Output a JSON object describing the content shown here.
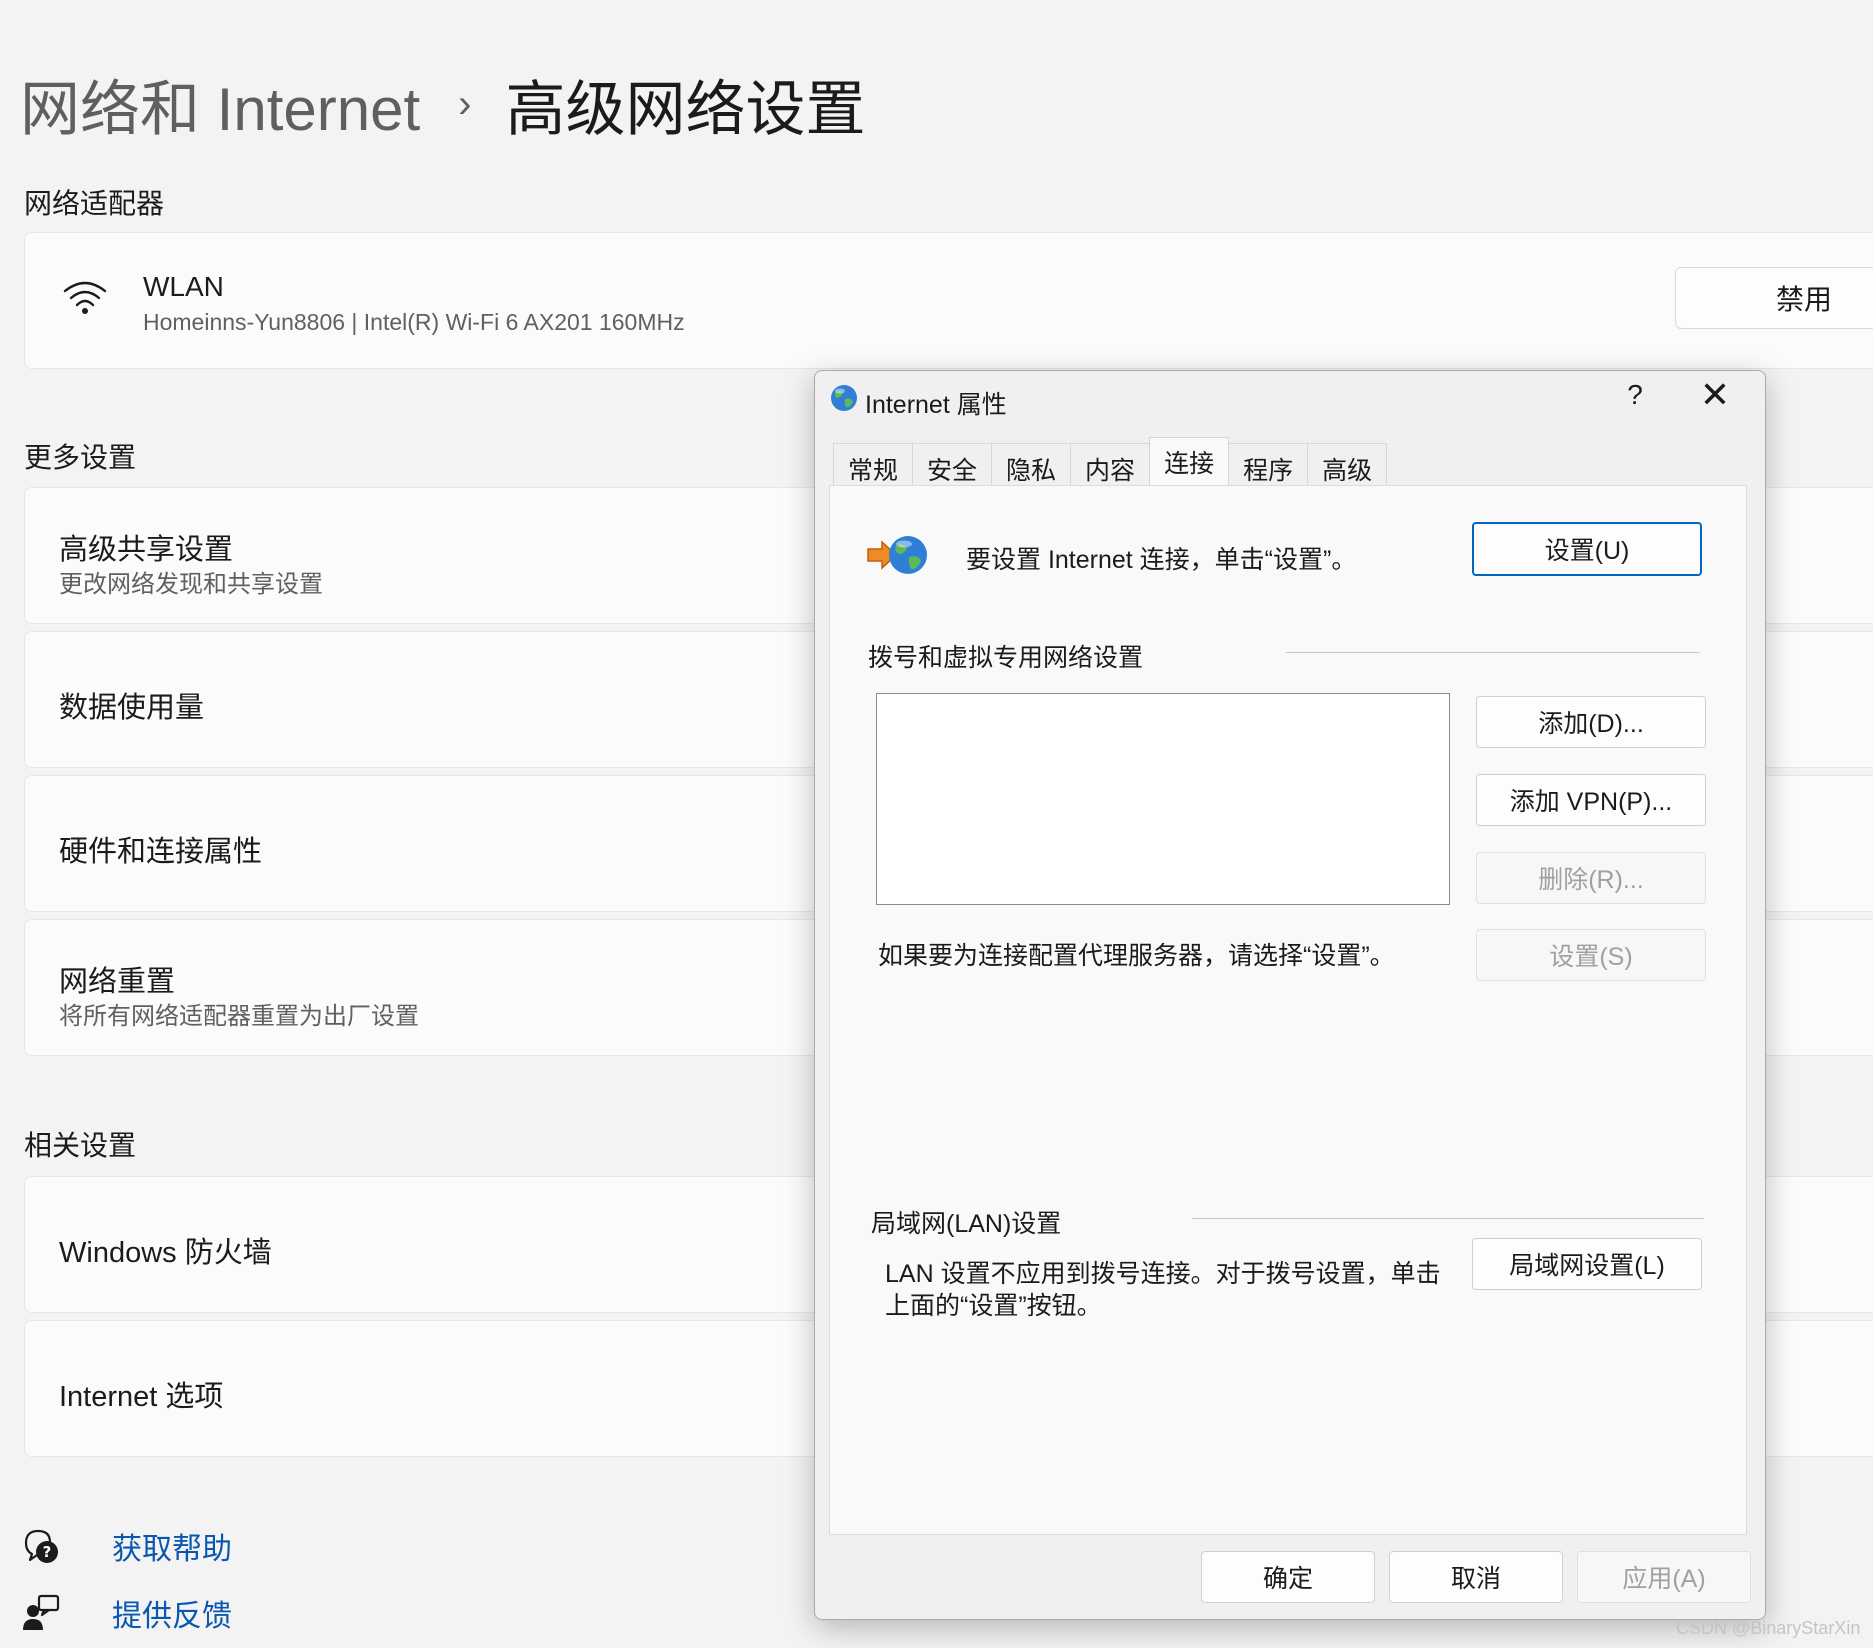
{
  "breadcrumb": {
    "parent": "网络和 Internet",
    "separator": "›",
    "current": "高级网络设置"
  },
  "adapters_section": {
    "title": "网络适配器",
    "adapter": {
      "name": "WLAN",
      "description": "Homeinns-Yun8806 | Intel(R) Wi-Fi 6 AX201 160MHz",
      "button": "禁用",
      "icon": "wifi-icon"
    }
  },
  "more_settings": {
    "title": "更多设置",
    "items": [
      {
        "title": "高级共享设置",
        "subtitle": "更改网络发现和共享设置"
      },
      {
        "title": "数据使用量"
      },
      {
        "title": "硬件和连接属性"
      },
      {
        "title": "网络重置",
        "subtitle": "将所有网络适配器重置为出厂设置"
      }
    ]
  },
  "related_settings": {
    "title": "相关设置",
    "items": [
      {
        "title": "Windows 防火墙"
      },
      {
        "title": "Internet 选项"
      }
    ]
  },
  "footer_links": [
    {
      "label": "获取帮助",
      "icon": "help-chat-icon"
    },
    {
      "label": "提供反馈",
      "icon": "feedback-icon"
    }
  ],
  "dialog": {
    "title": "Internet 属性",
    "help": "?",
    "tabs": [
      "常规",
      "安全",
      "隐私",
      "内容",
      "连接",
      "程序",
      "高级"
    ],
    "active_tab": "连接",
    "setup_text": "要设置 Internet 连接，单击“设置”。",
    "setup_button": "设置(U)",
    "dialup_header": "拨号和虚拟专用网络设置",
    "add_button": "添加(D)...",
    "add_vpn_button": "添加 VPN(P)...",
    "remove_button": "删除(R)...",
    "settings_button": "设置(S)",
    "proxy_text": "如果要为连接配置代理服务器，请选择“设置”。",
    "lan_header": "局域网(LAN)设置",
    "lan_text_line1": "LAN 设置不应用到拨号连接。对于拨号设置，单击",
    "lan_text_line2": "上面的“设置”按钮。",
    "lan_button": "局域网设置(L)",
    "ok_button": "确定",
    "cancel_button": "取消",
    "apply_button": "应用(A)"
  },
  "watermark": "CSDN @BinaryStarXin",
  "colors": {
    "accent": "#0067c0",
    "link": "#0a57b0",
    "background": "#f3f3f3"
  }
}
